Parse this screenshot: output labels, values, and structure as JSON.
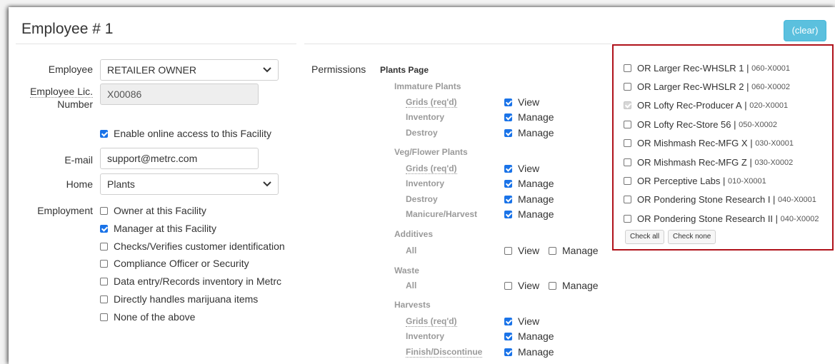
{
  "page": {
    "title": "Employee # 1",
    "clear_label": "(clear)"
  },
  "form": {
    "employee_label": "Employee",
    "employee_value": "RETAILER OWNER",
    "lic_label_1": "Employee Lic.",
    "lic_label_2": "Number",
    "lic_value": "X00086",
    "online_access_label": "Enable online access to this Facility",
    "email_label": "E-mail",
    "email_value": "support@metrc.com",
    "home_label": "Home",
    "home_value": "Plants",
    "employment_label": "Employment",
    "employment_options": [
      {
        "label": "Owner at this Facility",
        "checked": false
      },
      {
        "label": "Manager at this Facility",
        "checked": true
      },
      {
        "label": "Checks/Verifies customer identification",
        "checked": false
      },
      {
        "label": "Compliance Officer or Security",
        "checked": false
      },
      {
        "label": "Data entry/Records inventory in Metrc",
        "checked": false
      },
      {
        "label": "Directly handles marijuana items",
        "checked": false
      },
      {
        "label": "None of the above",
        "checked": false
      }
    ]
  },
  "permissions": {
    "label": "Permissions",
    "page_title": "Plants Page",
    "view_label": "View",
    "manage_label": "Manage",
    "groups": [
      {
        "name": "Immature Plants",
        "items": [
          {
            "name": "Grids (req'd)",
            "view": true
          },
          {
            "name": "Inventory",
            "manage": true
          },
          {
            "name": "Destroy",
            "manage": true
          }
        ]
      },
      {
        "name": "Veg/Flower Plants",
        "items": [
          {
            "name": "Grids (req'd)",
            "view": true
          },
          {
            "name": "Inventory",
            "manage": true
          },
          {
            "name": "Destroy",
            "manage": true
          },
          {
            "name": "Manicure/Harvest",
            "manage": true
          }
        ]
      },
      {
        "name": "Additives",
        "items": [
          {
            "name": "All",
            "view": false,
            "manage": false
          }
        ]
      },
      {
        "name": "Waste",
        "items": [
          {
            "name": "All",
            "view": false,
            "manage": false
          }
        ]
      },
      {
        "name": "Harvests",
        "items": [
          {
            "name": "Grids (req'd)",
            "view": true
          },
          {
            "name": "Inventory",
            "manage": true
          },
          {
            "name": "Finish/Discontinue",
            "manage": true
          }
        ]
      }
    ]
  },
  "facilities": {
    "items": [
      {
        "name": "OR Larger Rec-WHSLR 1",
        "license": "060-X0001",
        "checked": false
      },
      {
        "name": "OR Larger Rec-WHSLR 2",
        "license": "060-X0002",
        "checked": false
      },
      {
        "name": "OR Lofty Rec-Producer A",
        "license": "020-X0001",
        "checked": true,
        "disabled": true
      },
      {
        "name": "OR Lofty Rec-Store 56",
        "license": "050-X0002",
        "checked": false
      },
      {
        "name": "OR Mishmash Rec-MFG X",
        "license": "030-X0001",
        "checked": false
      },
      {
        "name": "OR Mishmash Rec-MFG Z",
        "license": "030-X0002",
        "checked": false
      },
      {
        "name": "OR Perceptive Labs",
        "license": "010-X0001",
        "checked": false
      },
      {
        "name": "OR Pondering Stone Research I",
        "license": "040-X0001",
        "checked": false
      },
      {
        "name": "OR Pondering Stone Research II",
        "license": "040-X0002",
        "checked": false
      }
    ],
    "separator": " | ",
    "check_all_label": "Check all",
    "check_none_label": "Check none"
  },
  "colors": {
    "clear_button": "#5bc0de",
    "checkbox_on": "#1a73e8",
    "highlight_border": "#b0121b"
  }
}
